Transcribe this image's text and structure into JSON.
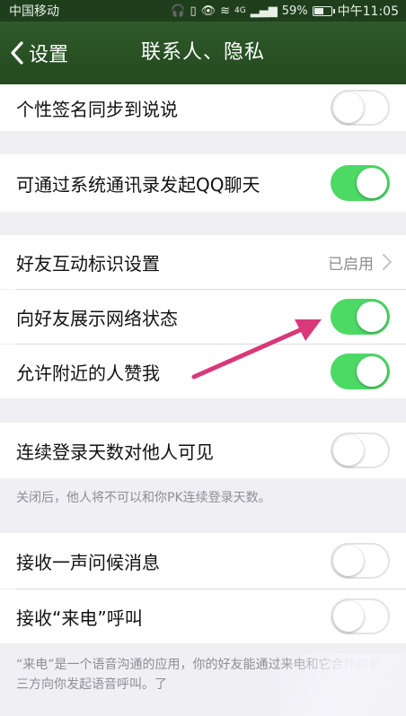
{
  "status_bar": {
    "carrier": "中国移动",
    "signal_label": "4G",
    "battery": "59%",
    "time": "中午11:05"
  },
  "nav": {
    "back_label": "设置",
    "title": "联系人、隐私"
  },
  "rows": {
    "signature_sync": {
      "label": "个性签名同步到说说",
      "on": false
    },
    "system_contacts": {
      "label": "可通过系统通讯录发起QQ聊天",
      "on": true
    },
    "friend_interaction": {
      "label": "好友互动标识设置",
      "value": "已启用"
    },
    "network_status": {
      "label": "向好友展示网络状态",
      "on": true
    },
    "nearby_like": {
      "label": "允许附近的人赞我",
      "on": true
    },
    "login_days": {
      "label": "连续登录天数对他人可见",
      "on": false
    },
    "greeting": {
      "label": "接收一声问候消息",
      "on": false
    },
    "laidian": {
      "label": "接收“来电”呼叫",
      "on": false
    }
  },
  "notes": {
    "login_days_note": "关闭后，他人将不可以和你PK连续登录天数。",
    "laidian_note": "“来电”是一个语音沟通的应用，你的好友能通过来电和它合作的第三方向你发起语音呼叫。了"
  },
  "colors": {
    "nav_green": "#2e5a2a",
    "toggle_on": "#4cd964",
    "annotation_arrow": "#d9387a"
  }
}
